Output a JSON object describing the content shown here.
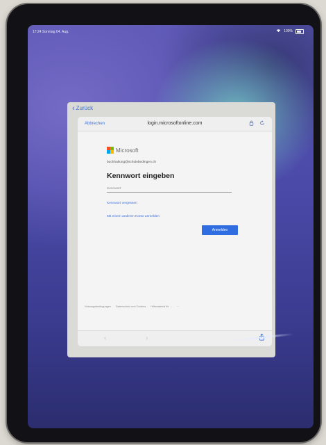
{
  "status_bar": {
    "time": "17:24",
    "date": "Sonntag 04. Aug.",
    "battery_text": "100%"
  },
  "sheet": {
    "back_label": "Zurück"
  },
  "browser": {
    "cancel_label": "Abbrechen",
    "url": "login.microsoftonline.com",
    "lock_icon": "lock-icon",
    "reload_icon": "reload-icon"
  },
  "login": {
    "brand": "Microsoft",
    "brand_colors": [
      "#f25022",
      "#7fba00",
      "#00a4ef",
      "#ffb900"
    ],
    "email": "buchhaltung@schulebedingen.ch",
    "heading": "Kennwort eingeben",
    "password_placeholder": "Kennwort",
    "forgot_link": "Kennwort vergessen",
    "other_account_link": "Mit einem anderen Konto anmelden",
    "signin_label": "Anmelden"
  },
  "footer": {
    "links": [
      "Nutzungsbedingungen",
      "Datenschutz und Cookies",
      "Hilfsmaterial für ...",
      "···"
    ]
  },
  "toolbar": {
    "back_glyph": "‹",
    "forward_glyph": "›",
    "share_icon": "share-icon"
  },
  "colors": {
    "accent": "#2f6de0",
    "link": "#3f6ed8"
  }
}
